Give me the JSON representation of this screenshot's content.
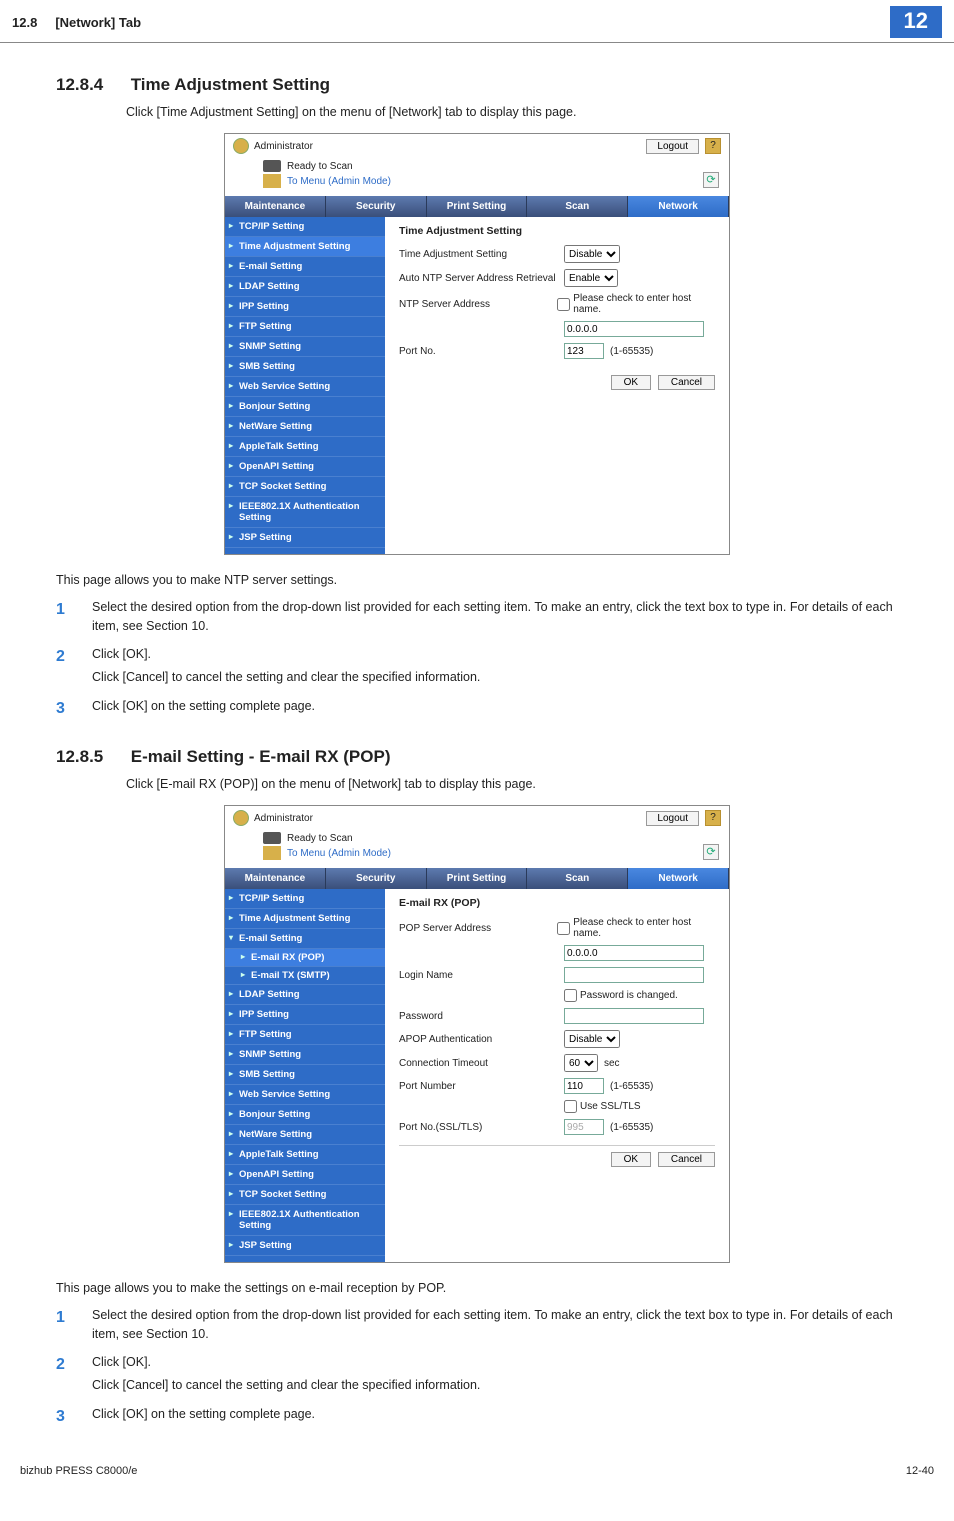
{
  "header": {
    "section_num": "12.8",
    "tab_name": "[Network] Tab",
    "chapter": "12"
  },
  "section_1": {
    "num": "12.8.4",
    "title": "Time Adjustment Setting",
    "intro": "Click [Time Adjustment Setting] on the menu of [Network] tab to display this page.",
    "desc": "This page allows you to make NTP server settings.",
    "steps": {
      "s1_num": "1",
      "s1_text": "Select the desired option from the drop-down list provided for each setting item. To make an entry, click the text box to type in. For details of each item, see Section 10.",
      "s2_num": "2",
      "s2_text": "Click [OK].",
      "s2_sub": "Click [Cancel] to cancel the setting and clear the specified information.",
      "s3_num": "3",
      "s3_text": "Click [OK] on the setting complete page."
    }
  },
  "section_2": {
    "num": "12.8.5",
    "title": "E-mail Setting - E-mail RX (POP)",
    "intro": "Click [E-mail RX (POP)] on the menu of [Network] tab to display this page.",
    "desc": "This page allows you to make the settings on e-mail reception by POP.",
    "steps": {
      "s1_num": "1",
      "s1_text": "Select the desired option from the drop-down list provided for each setting item. To make an entry, click the text box to type in. For details of each item, see Section 10.",
      "s2_num": "2",
      "s2_text": "Click [OK].",
      "s2_sub": "Click [Cancel] to cancel the setting and clear the specified information.",
      "s3_num": "3",
      "s3_text": "Click [OK] on the setting complete page."
    }
  },
  "shot_common": {
    "admin": "Administrator",
    "logout": "Logout",
    "help_q": "?",
    "status_ready": "Ready to Scan",
    "to_menu": "To Menu (Admin Mode)",
    "refresh_glyph": "⟳",
    "tabs": {
      "maintenance": "Maintenance",
      "security": "Security",
      "print": "Print Setting",
      "scan": "Scan",
      "network": "Network"
    }
  },
  "nav_items": {
    "tcpip": "TCP/IP Setting",
    "time": "Time Adjustment Setting",
    "email": "E-mail Setting",
    "email_rx": "E-mail RX (POP)",
    "email_tx": "E-mail TX (SMTP)",
    "ldap": "LDAP Setting",
    "ipp": "IPP Setting",
    "ftp": "FTP Setting",
    "snmp": "SNMP Setting",
    "smb": "SMB Setting",
    "websvc": "Web Service Setting",
    "bonjour": "Bonjour Setting",
    "netware": "NetWare Setting",
    "appletalk": "AppleTalk Setting",
    "openapi": "OpenAPI Setting",
    "tcpsocket": "TCP Socket Setting",
    "ieee": "IEEE802.1X Authentication Setting",
    "jsp": "JSP Setting"
  },
  "shot1": {
    "heading": "Time Adjustment Setting",
    "r1_label": "Time Adjustment Setting",
    "r1_value": "Disable",
    "r2_label": "Auto NTP Server Address Retrieval",
    "r2_value": "Enable",
    "r3_label": "NTP Server Address",
    "r3_cb_label": "Please check to enter host name.",
    "r3_value": "0.0.0.0",
    "r4_label": "Port No.",
    "r4_value": "123",
    "r4_hint": "(1-65535)",
    "ok": "OK",
    "cancel": "Cancel"
  },
  "shot2": {
    "heading": "E-mail RX (POP)",
    "r1_label": "POP Server Address",
    "r1_cb_label": "Please check to enter host name.",
    "r1_value": "0.0.0.0",
    "r2_label": "Login Name",
    "r2_value": "",
    "r3_cb_label": "Password is changed.",
    "r4_label": "Password",
    "r4_value": "",
    "r5_label": "APOP Authentication",
    "r5_value": "Disable",
    "r6_label": "Connection Timeout",
    "r6_value": "60",
    "r6_unit": "sec",
    "r7_label": "Port Number",
    "r7_value": "110",
    "r7_hint": "(1-65535)",
    "r8_cb_label": "Use SSL/TLS",
    "r9_label": "Port No.(SSL/TLS)",
    "r9_value": "995",
    "r9_hint": "(1-65535)",
    "ok": "OK",
    "cancel": "Cancel"
  },
  "footer": {
    "product": "bizhub PRESS C8000/e",
    "pageno": "12-40"
  }
}
